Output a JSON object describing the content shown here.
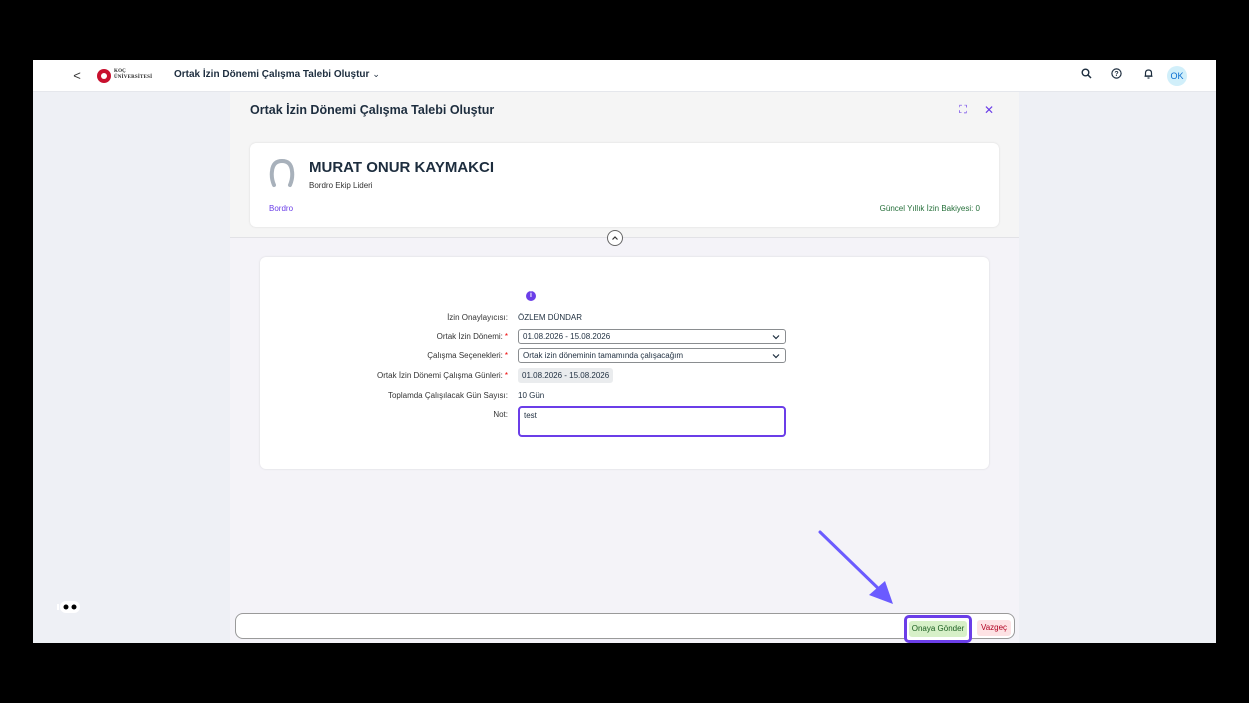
{
  "shell": {
    "back": "<",
    "logo_line1": "KOÇ",
    "logo_line2": "ÜNİVERSİTESİ",
    "app_title": "Ortak İzin Dönemi Çalışma Talebi Oluştur",
    "app_title_chevron": "⌄",
    "avatar_initials": "OK"
  },
  "dialog": {
    "title": "Ortak İzin Dönemi Çalışma Talebi Oluştur",
    "fullscreen_glyph": "⛶",
    "close_glyph": "✕"
  },
  "profile": {
    "name": "MURAT ONUR KAYMAKCI",
    "role": "Bordro Ekip Lideri",
    "department": "Bordro",
    "balance": "Güncel Yıllık İzin Bakiyesi: 0"
  },
  "form": {
    "info_glyph": "i",
    "approver_label": "İzin Onaylayıcısı:",
    "approver_value": "ÖZLEM DÜNDAR",
    "period_label": "Ortak İzin Dönemi:",
    "period_value": "01.08.2026 - 15.08.2026",
    "options_label": "Çalışma Seçenekleri:",
    "options_value": "Ortak izin döneminin tamamında çalışacağım",
    "days_label": "Ortak İzin Dönemi Çalışma Günleri:",
    "days_value": "01.08.2026 - 15.08.2026",
    "total_label": "Toplamda Çalışılacak Gün Sayısı:",
    "total_value": "10 Gün",
    "note_label": "Not:",
    "note_value": "test"
  },
  "footer": {
    "send_label": "Onaya Gönder",
    "cancel_label": "Vazgeç"
  },
  "colors": {
    "accent": "#6b3ee8",
    "send_bg": "#d7f0c8",
    "cancel_bg": "#fde2e4"
  }
}
